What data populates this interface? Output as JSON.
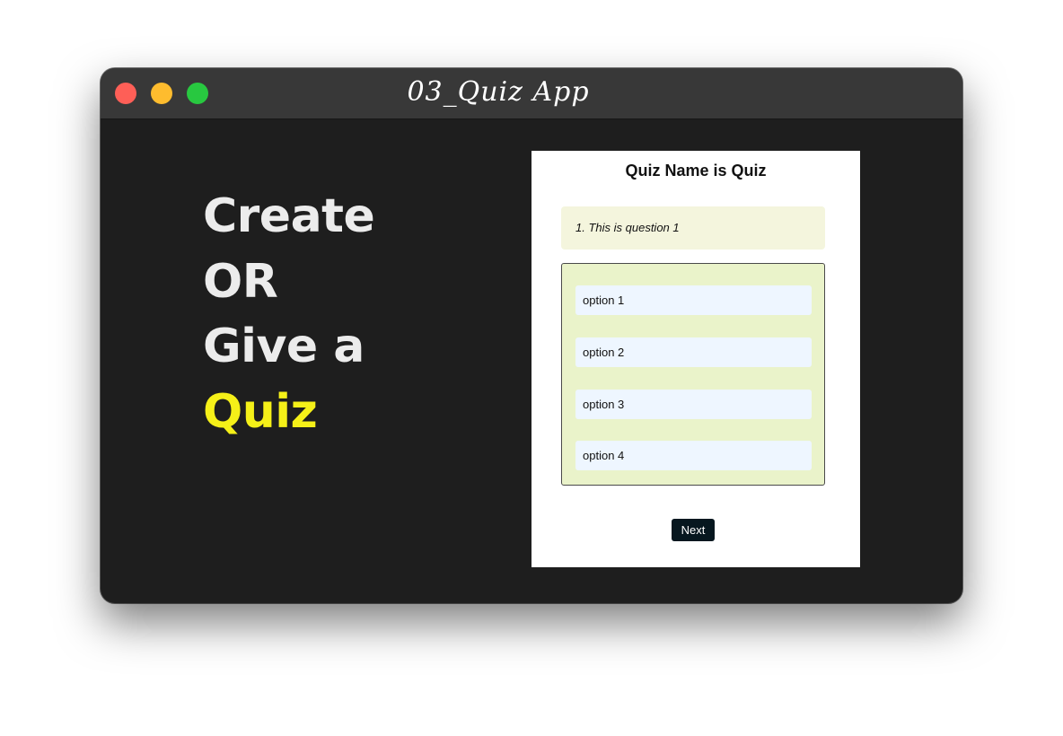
{
  "window": {
    "title": "03_Quiz App",
    "controls": {
      "close_color": "#fe5f57",
      "minimize_color": "#febc2e",
      "maximize_color": "#28c840"
    }
  },
  "hero": {
    "line1": "Create",
    "line2": "OR",
    "line3": "Give a",
    "line4": "Quiz",
    "accent_color": "#f5f018"
  },
  "quiz": {
    "title": "Quiz Name is Quiz",
    "question": "1. This is question 1",
    "options": [
      "option 1",
      "option 2",
      "option 3",
      "option 4"
    ],
    "next_label": "Next"
  }
}
